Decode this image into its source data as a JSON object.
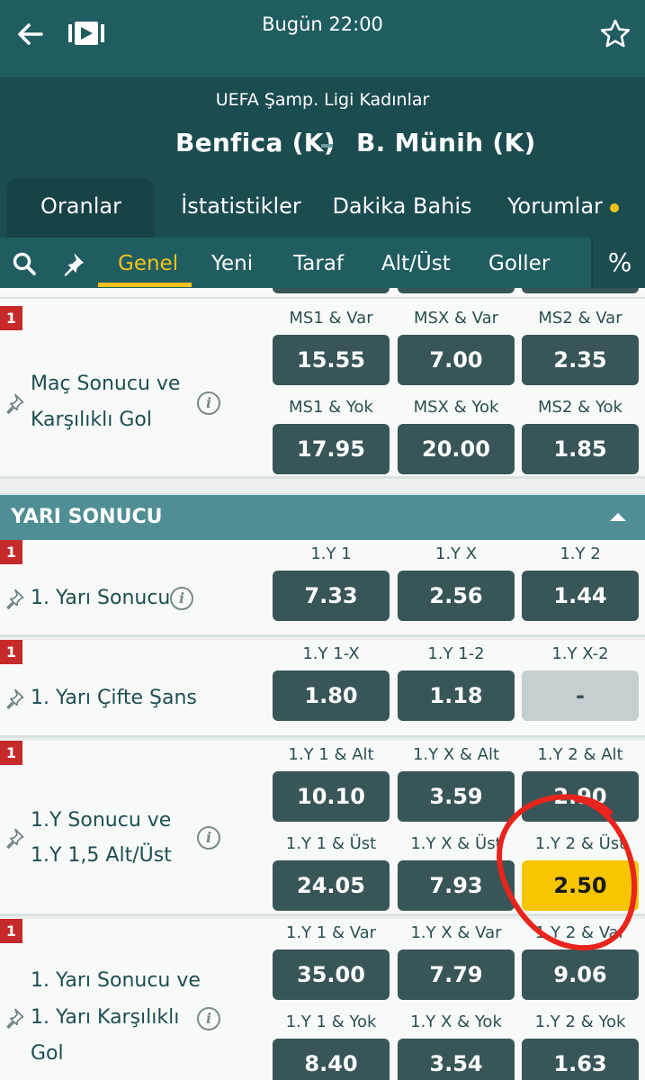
{
  "header": {
    "time": "Bugün 22:00",
    "league": "UEFA Şamp. Ligi Kadınlar",
    "home": "Benfica (K)",
    "away": "B. Münih (K)"
  },
  "tabs": [
    "Oranlar",
    "İstatistikler",
    "Dakika Bahis",
    "Yorumlar"
  ],
  "chips": [
    "Genel",
    "Yeni",
    "Taraf",
    "Alt/Üst",
    "Goller"
  ],
  "percent": "%",
  "section": {
    "title": "YARI SONUCU"
  },
  "markets": [
    {
      "flag": "1",
      "title": [
        "Maç Sonucu ve",
        "Karşılıklı Gol"
      ],
      "info": "i",
      "rows": [
        {
          "labels": [
            "MS1 & Var",
            "MSX & Var",
            "MS2 & Var"
          ],
          "odds": [
            "15.55",
            "7.00",
            "2.35"
          ]
        },
        {
          "labels": [
            "MS1 & Yok",
            "MSX & Yok",
            "MS2 & Yok"
          ],
          "odds": [
            "17.95",
            "20.00",
            "1.85"
          ]
        }
      ]
    },
    {
      "flag": "1",
      "title": [
        "1. Yarı Sonucu"
      ],
      "info": "i",
      "rows": [
        {
          "labels": [
            "1.Y 1",
            "1.Y X",
            "1.Y 2"
          ],
          "odds": [
            "7.33",
            "2.56",
            "1.44"
          ]
        }
      ]
    },
    {
      "flag": "1",
      "title": [
        "1. Yarı Çifte Şans"
      ],
      "rows": [
        {
          "labels": [
            "1.Y 1-X",
            "1.Y 1-2",
            "1.Y X-2"
          ],
          "odds": [
            "1.80",
            "1.18",
            "-"
          ]
        }
      ]
    },
    {
      "flag": "1",
      "title": [
        "1.Y Sonucu ve",
        "1.Y 1,5 Alt/Üst"
      ],
      "info": "i",
      "rows": [
        {
          "labels": [
            "1.Y 1 & Alt",
            "1.Y X & Alt",
            "1.Y 2 & Alt"
          ],
          "odds": [
            "10.10",
            "3.59",
            "2.90"
          ]
        },
        {
          "labels": [
            "1.Y 1 & Üst",
            "1.Y X & Üst",
            "1.Y 2 & Üst"
          ],
          "odds": [
            "24.05",
            "7.93",
            "2.50"
          ]
        }
      ]
    },
    {
      "flag": "1",
      "title": [
        "1. Yarı Sonucu ve",
        "1. Yarı Karşılıklı",
        "Gol"
      ],
      "info": "i",
      "rows": [
        {
          "labels": [
            "1.Y 1 & Var",
            "1.Y X & Var",
            "1.Y 2 & Var"
          ],
          "odds": [
            "35.00",
            "7.79",
            "9.06"
          ]
        },
        {
          "labels": [
            "1.Y 1 & Yok",
            "1.Y X & Yok",
            "1.Y 2 & Yok"
          ],
          "odds": [
            "8.40",
            "3.54",
            "1.63"
          ]
        }
      ]
    }
  ],
  "colors": {
    "header": "#1f5d60",
    "odd_button": "#385558",
    "selected": "#f7c600",
    "flag": "#c62a2b",
    "annotation": "#e8241c"
  },
  "selected_odd": "1.Y 2 & Üst"
}
